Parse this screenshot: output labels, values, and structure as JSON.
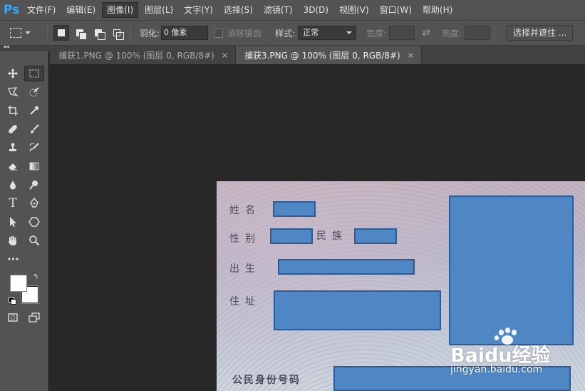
{
  "app": {
    "logo": "Ps"
  },
  "menu": {
    "items": [
      {
        "label": "文件(F)"
      },
      {
        "label": "编辑(E)"
      },
      {
        "label": "图像(I)"
      },
      {
        "label": "图层(L)"
      },
      {
        "label": "文字(Y)"
      },
      {
        "label": "选择(S)"
      },
      {
        "label": "滤镜(T)"
      },
      {
        "label": "3D(D)"
      },
      {
        "label": "视图(V)"
      },
      {
        "label": "窗口(W)"
      },
      {
        "label": "帮助(H)"
      }
    ],
    "active_index": 2
  },
  "options": {
    "feather_label": "羽化:",
    "feather_value": "0 像素",
    "antialias_label": "消除锯齿",
    "style_label": "样式:",
    "style_value": "正常",
    "width_label": "宽度:",
    "height_label": "高度:",
    "select_mask_label": "选择并遮住 ..."
  },
  "tabs": [
    {
      "label": "捕获1.PNG @ 100% (图层 0, RGB/8#)",
      "active": false
    },
    {
      "label": "捕获3.PNG @ 100% (图层 0, RGB/8#)",
      "active": true
    }
  ],
  "tab_close_glyph": "×",
  "toolbar": {
    "text_tool_glyph": "T",
    "more_glyph": "•••",
    "swap_glyph": "⇄",
    "collapse_glyph": "◂◂"
  },
  "document": {
    "labels": {
      "name": "姓名",
      "gender": "性别",
      "ethnicity": "民族",
      "birth": "出生",
      "address": "住址",
      "id_number": "公民身份号码"
    }
  },
  "watermark": {
    "brand": "Baidu经验",
    "url": "jingyan.baidu.com"
  },
  "colors": {
    "app_bg": "#282828",
    "panel": "#535353",
    "accent_logo": "#31a8ff",
    "redaction_fill": "#4f86c4",
    "redaction_border": "#2f5b94"
  }
}
